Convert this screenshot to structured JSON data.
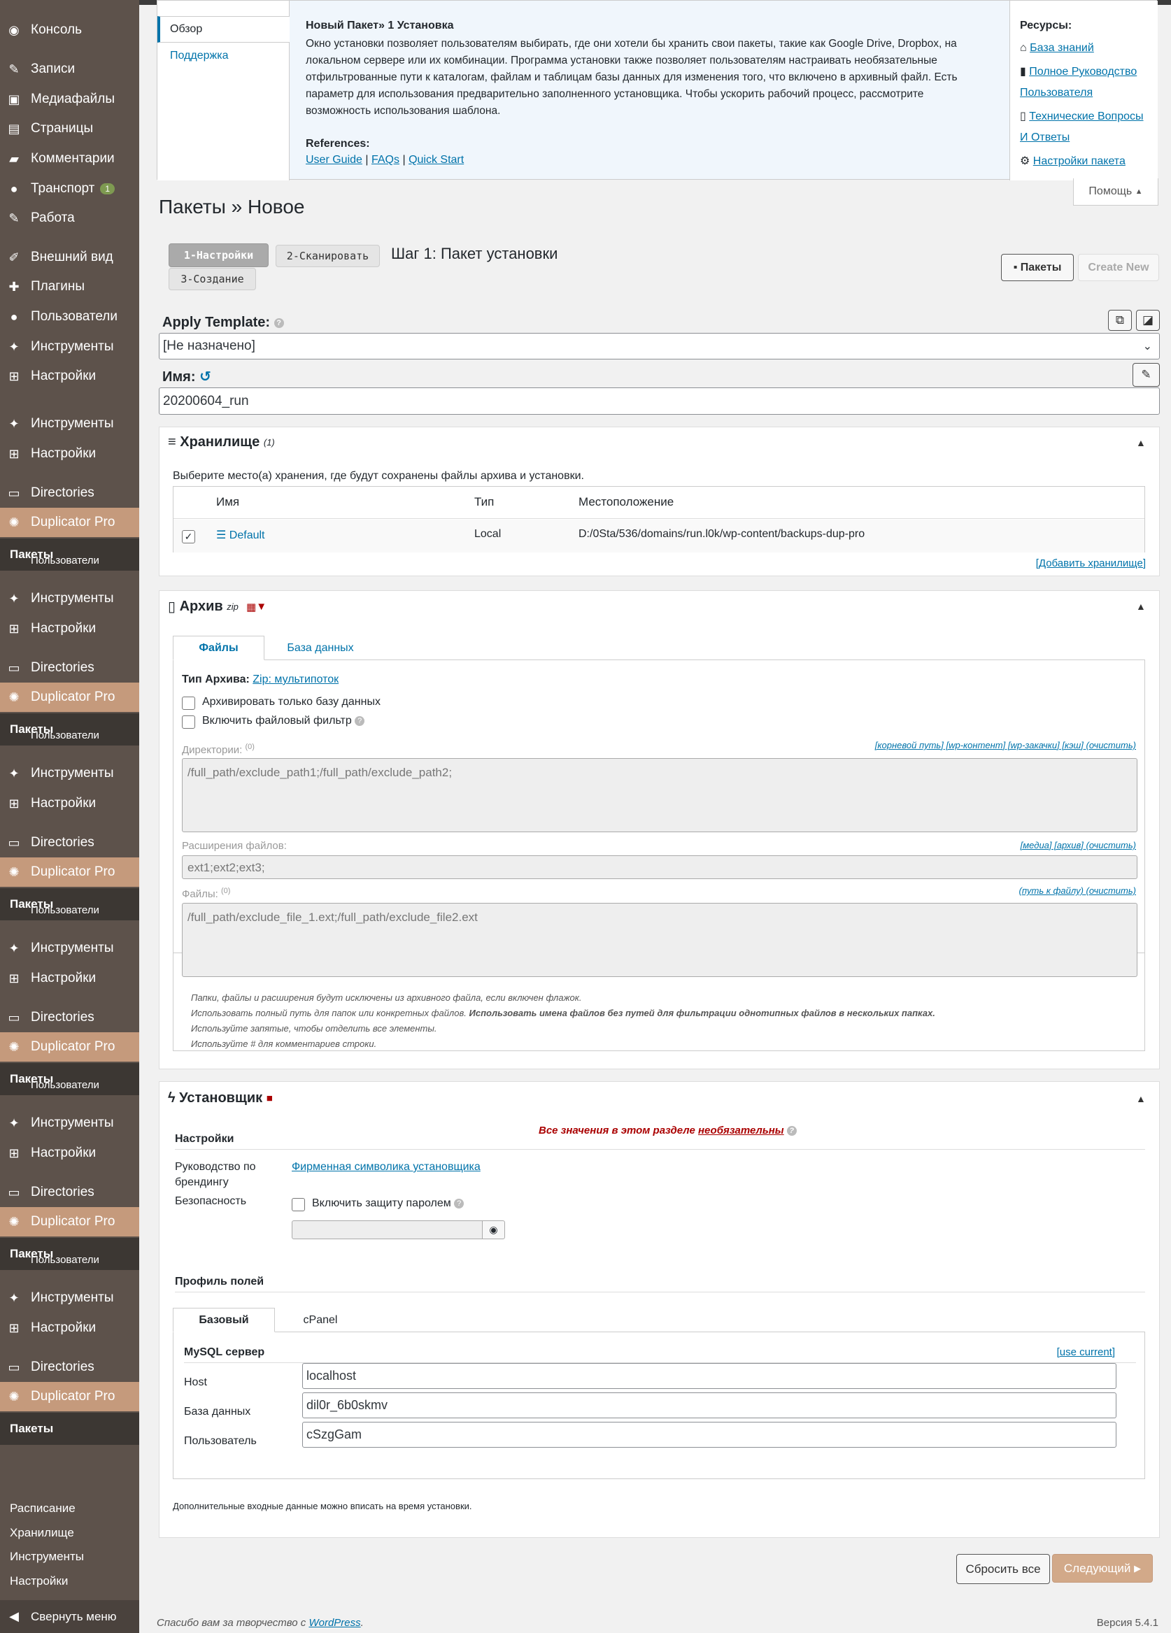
{
  "sidebar": {
    "items": [
      {
        "label": "Консоль",
        "icon": "dashboard-icon"
      },
      {
        "label": "Записи",
        "icon": "pin-icon"
      },
      {
        "label": "Медиафайлы",
        "icon": "media-icon"
      },
      {
        "label": "Страницы",
        "icon": "pages-icon"
      },
      {
        "label": "Комментарии",
        "icon": "comment-icon"
      },
      {
        "label": "Транспорт",
        "icon": "user-icon",
        "badge": "1"
      },
      {
        "label": "Работа",
        "icon": "pin-icon"
      },
      {
        "label": "Внешний вид",
        "icon": "appearance-icon"
      },
      {
        "label": "Плагины",
        "icon": "plugin-icon"
      },
      {
        "label": "Пользователи",
        "icon": "user-icon"
      },
      {
        "label": "Инструменты",
        "icon": "wrench-icon"
      },
      {
        "label": "Настройки",
        "icon": "settings-icon"
      }
    ],
    "truncated_label": "Пользователи",
    "tools": "Инструменты",
    "settings": "Настройки",
    "directories": "Directories",
    "duplicator": "Duplicator Pro",
    "packages": "Пакеты",
    "sub_items": [
      "Расписание",
      "Хранилище",
      "Инструменты",
      "Настройки"
    ],
    "collapse": "Свернуть меню"
  },
  "help_panel": {
    "tab_overview": "Обзор",
    "tab_support": "Поддержка",
    "title": "Новый Пакет» 1 Установка",
    "body": "Окно установки позволяет пользователям выбирать, где они хотели бы хранить свои пакеты, такие как Google Drive, Dropbox, на локальном сервере или их комбинации. Программа установки также позволяет пользователям настраивать необязательные отфильтрованные пути к каталогам, файлам и таблицам базы данных для изменения того, что включено в архивный файл. Есть параметр для использования предварительно заполненного установщика. Чтобы ускорить рабочий процесс, рассмотрите возможность использования шаблона.",
    "references_label": "References:",
    "ref_user_guide": "User Guide",
    "ref_faqs": "FAQs",
    "ref_quick_start": "Quick Start",
    "sep": "|",
    "resources_label": "Ресурсы:",
    "res_kb": "База знаний",
    "res_guide_1": "Полное Руководство",
    "res_guide_2": "Пользователя",
    "res_faq_1": "Технические Вопросы",
    "res_faq_2": "И Ответы",
    "res_settings": "Настройки пакета",
    "help_button": "Помощь"
  },
  "page": {
    "title": "Пакеты » Новое",
    "step1": "1-Настройки",
    "step2": "2-Сканировать",
    "step3": "3-Создание",
    "step_title": "Шаг 1: Пакет установки",
    "packages_btn": "Пакеты",
    "create_new_btn": "Create New"
  },
  "template": {
    "label": "Apply Template:",
    "value": "[Не назначено]"
  },
  "name": {
    "label": "Имя:",
    "value": "20200604_run"
  },
  "storage": {
    "title": "Хранилище",
    "count": "(1)",
    "desc": "Выберите место(а) хранения, где будут сохранены файлы архива и установки.",
    "col_name": "Имя",
    "col_type": "Тип",
    "col_location": "Местоположение",
    "row_name": "Default",
    "row_type": "Local",
    "row_location": "D:/0Sta/536/domains/run.l0k/wp-content/backups-dup-pro",
    "add_link": "[Добавить хранилище]"
  },
  "archive": {
    "title": "Архив",
    "sup": "zip",
    "tab_files": "Файлы",
    "tab_db": "База данных",
    "type_label": "Тип Архива:",
    "type_value": "Zip: мультипоток",
    "only_db": "Архивировать только базу данных",
    "file_filter": "Включить файловый фильтр",
    "dirs_label": "Директории:",
    "dirs_count": "(0)",
    "dirs_links": "[корневой путь] [wp-контент] [wp-закачки] [кэш] (очистить)",
    "dirs_placeholder": "/full_path/exclude_path1;/full_path/exclude_path2;",
    "ext_label": "Расширения файлов:",
    "ext_links": "[медиа] [архив] (очистить)",
    "ext_placeholder": "ext1;ext2;ext3;",
    "files_label": "Файлы:",
    "files_count": "(0)",
    "files_links": "(путь к файлу) (очистить)",
    "files_placeholder": "/full_path/exclude_file_1.ext;/full_path/exclude_file2.ext",
    "note1": "Папки, файлы и расширения будут исключены из архивного файла, если включен флажок.",
    "note2a": "Использовать полный путь для папок или конкретных файлов.",
    "note2b": "Использовать имена файлов без путей для фильтрации однотипных файлов в нескольких папках.",
    "note3": "Используйте запятые, чтобы отделить все элементы.",
    "note4": "Используйте # для комментариев строки."
  },
  "installer": {
    "title": "Установщик",
    "settings_label": "Настройки",
    "optional_text": "Все значения в этом разделе",
    "optional_link": "необязательны",
    "branding_label_1": "Руководство по",
    "branding_label_2": "брендингу",
    "branding_link": "Фирменная символика установщика",
    "security_label": "Безопасность",
    "password_cb": "Включить защиту паролем",
    "profile_label": "Профиль полей",
    "tab_basic": "Базовый",
    "tab_cpanel": "cPanel",
    "mysql_label": "MySQL сервер",
    "use_current": "[use current]",
    "host_label": "Host",
    "host_value": "localhost",
    "db_label": "База данных",
    "db_value": "dil0r_6b0skmv",
    "user_label": "Пользователь",
    "user_value": "cSzgGam",
    "footer_note": "Дополнительные входные данные можно вписать на время установки."
  },
  "actions": {
    "reset": "Сбросить все",
    "next": "Следующий"
  },
  "footer": {
    "thanks": "Спасибо вам за творчество с ",
    "wp": "WordPress",
    "dot": ".",
    "version": "Версия 5.4.1"
  }
}
